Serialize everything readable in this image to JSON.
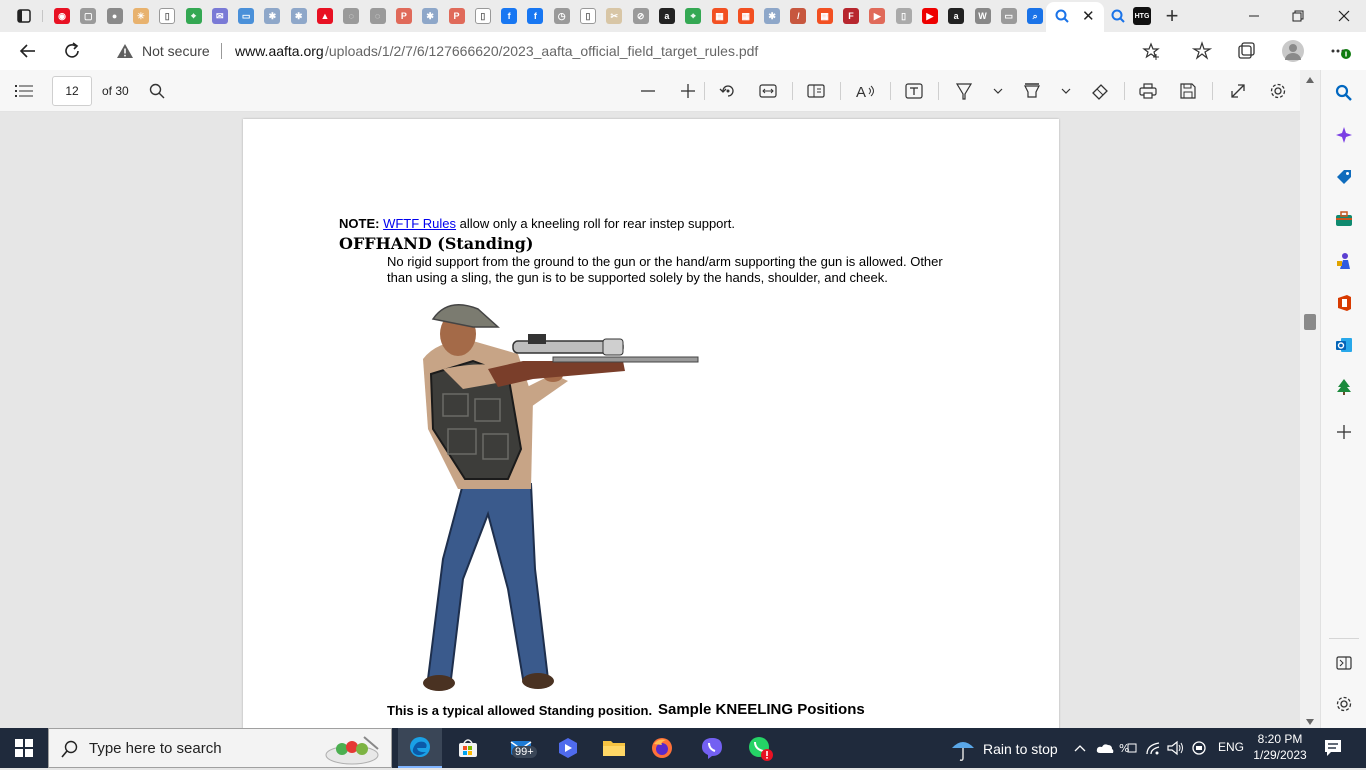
{
  "browser": {
    "address": {
      "security_label": "Not secure",
      "url_domain": "www.aafta.org",
      "url_path": "/uploads/1/2/7/6/127666620/2023_aafta_official_field_target_rules.pdf"
    },
    "active_tab_close": "✕",
    "new_tab": "+"
  },
  "pdf_toolbar": {
    "page_number": "12",
    "page_total": "of 30"
  },
  "document": {
    "note_label": "NOTE:",
    "note_link": "WFTF Rules",
    "note_text": " allow only a kneeling roll for rear instep support.",
    "heading": "OFFHAND (Standing)",
    "paragraph_line1": "No rigid support from the ground to the gun or the hand/arm supporting the gun is allowed. Other",
    "paragraph_line2": "than using a sling, the gun is to be supported solely by the hands, shoulder, and cheek.",
    "caption": "This is a typical allowed Standing position.",
    "next_heading": "Sample KNEELING Positions"
  },
  "taskbar": {
    "search_placeholder": "Type here to search",
    "mail_badge": "99+",
    "weather": "Rain to stop",
    "language": "ENG",
    "time": "8:20 PM",
    "date": "1/29/2023"
  },
  "colors": {
    "link": "#0000ee",
    "taskbar": "#1f2a3c",
    "accent": "#0067c0"
  }
}
